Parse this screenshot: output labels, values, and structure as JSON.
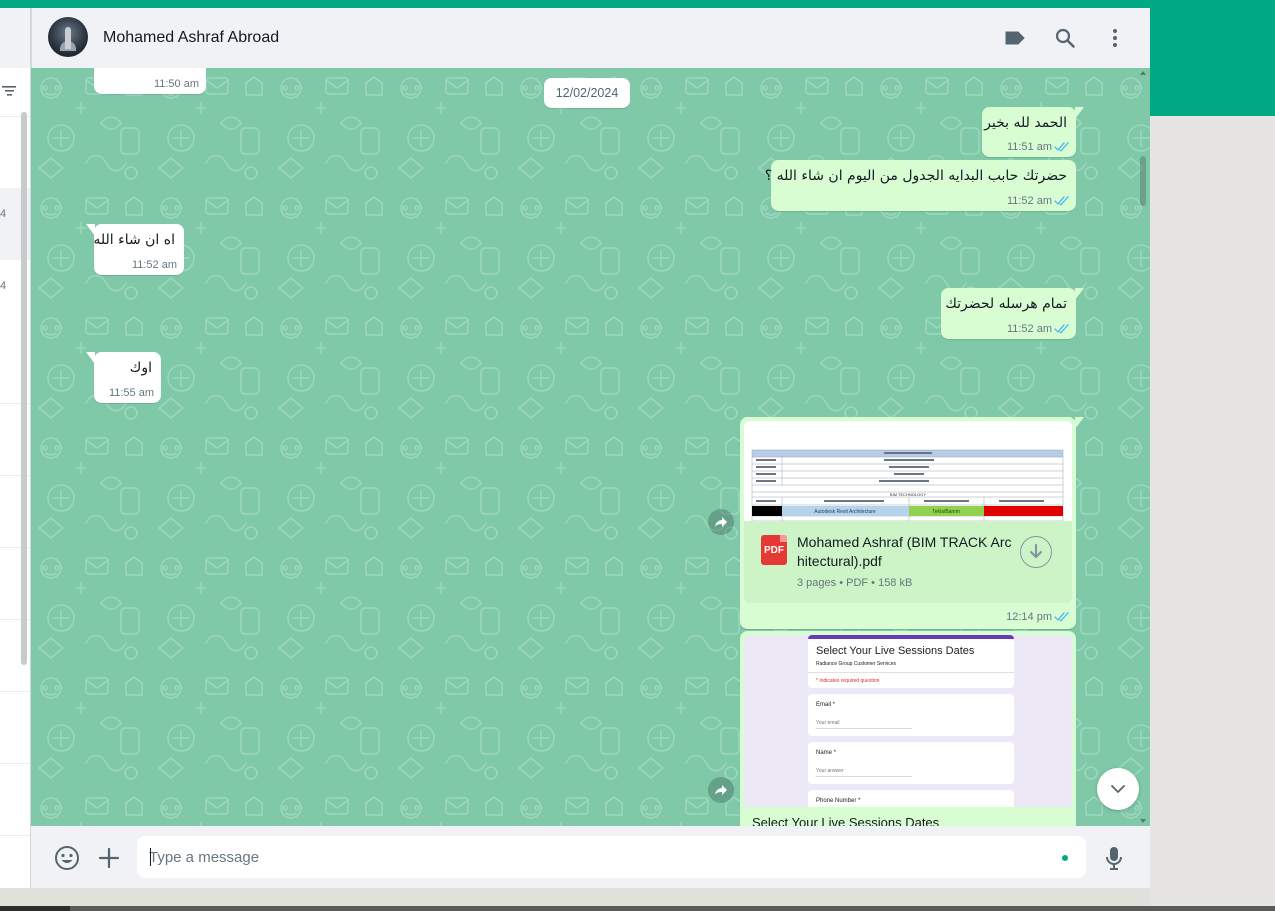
{
  "header": {
    "contact_name": "Mohamed Ashraf Abroad",
    "avatar": "mosque-photo-avatar",
    "icons": [
      "label-icon",
      "search-icon",
      "kebab-menu-icon"
    ]
  },
  "sidebar": {
    "counts": [
      "4",
      "4"
    ]
  },
  "date_chip": "12/02/2024",
  "messages": [
    {
      "dir": "in",
      "text": "",
      "time": "11:50 am"
    },
    {
      "dir": "out",
      "text": "الحمد لله بخير",
      "time": "11:51 am",
      "status": "read"
    },
    {
      "dir": "out",
      "text": "حضرتك حابب البدايه الجدول من اليوم ان شاء الله ؟",
      "time": "11:52 am",
      "status": "read"
    },
    {
      "dir": "in",
      "text": "اه ان شاء الله",
      "time": "11:52 am"
    },
    {
      "dir": "out",
      "text": "تمام هرسله لحضرتك",
      "time": "11:52 am",
      "status": "read"
    },
    {
      "dir": "in",
      "text": "اوك",
      "time": "11:55 am"
    }
  ],
  "document": {
    "file_name": "Mohamed Ashraf (BIM TRACK Architectural).pdf",
    "icon_label": "PDF",
    "meta": "3 pages • PDF • 158 kB",
    "time": "12:14 pm",
    "status": "read",
    "preview": {
      "row_labels": [
        "Autodesk Revit Architecture",
        "Tekla/Bamm",
        "BIM TECHNOLOGY"
      ]
    }
  },
  "form_message": {
    "preview_title": "Select Your Live Sessions Dates",
    "preview_subtitle": "Radiance Group Customer Services",
    "required_note": "* Indicates required question",
    "fields": [
      {
        "label": "Email *",
        "hint": "Your email"
      },
      {
        "label": "Name *",
        "hint": "Your answer"
      },
      {
        "label": "Phone Number *",
        "hint": ""
      }
    ],
    "caption": "Select Your Live Sessions Dates"
  },
  "composer": {
    "placeholder": "Type a message",
    "icons": [
      "emoji-icon",
      "attach-plus-icon",
      "microphone-icon"
    ]
  },
  "colors": {
    "brand": "#00a884",
    "outgoing_bubble": "#d9fdd3",
    "chat_wallpaper": "#7fc8a8",
    "read_ticks": "#53bdeb"
  }
}
